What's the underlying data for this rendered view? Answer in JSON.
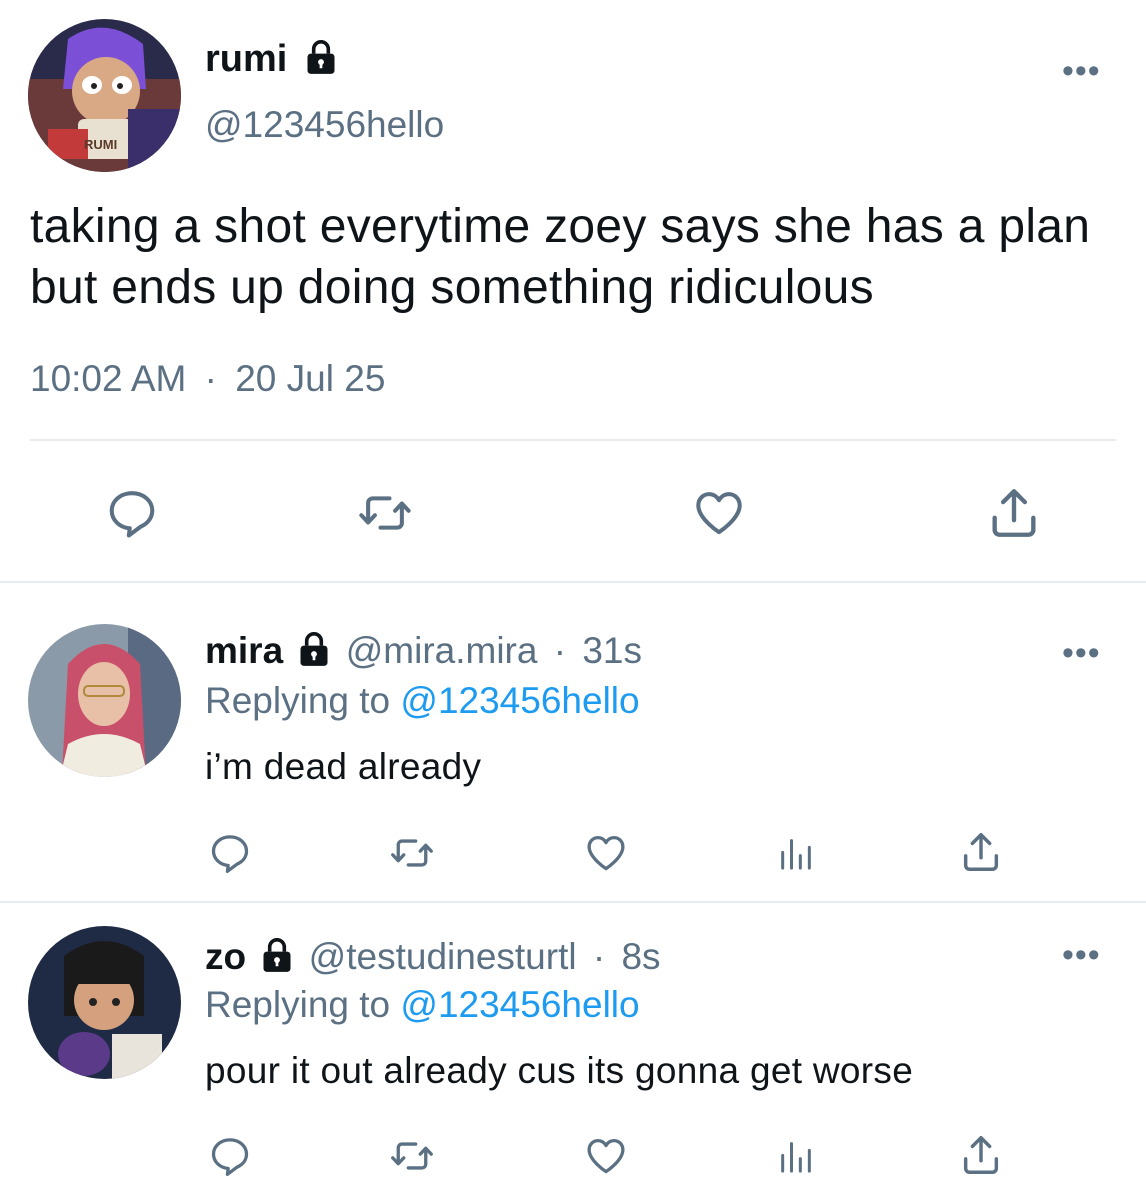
{
  "tweet": {
    "author_name": "rumi",
    "author_handle": "@123456hello",
    "text": "taking a shot everytime zoey says she has a plan but ends up doing something ridiculous",
    "time": "10:02 AM",
    "date": "20 Jul 25",
    "separator": "·",
    "more": "•••",
    "avatar_label": "RUMI"
  },
  "replies": [
    {
      "name": "mira",
      "handle": "@mira.mira",
      "age": "31s",
      "replying_prefix": "Replying to",
      "replying_handle": "@123456hello",
      "text": "i’m dead already"
    },
    {
      "name": "zo",
      "handle": "@testudinesturtl",
      "age": "8s",
      "replying_prefix": "Replying to",
      "replying_handle": "@123456hello",
      "text": "pour it out already cus its gonna get worse"
    }
  ],
  "colors": {
    "text": "#0f1419",
    "secondary": "#5b7083",
    "link": "#1d9bf0",
    "divider": "#e6ecf0"
  },
  "icons": [
    "lock-icon",
    "more-icon",
    "reply-icon",
    "retweet-icon",
    "like-icon",
    "analytics-icon",
    "share-icon"
  ]
}
